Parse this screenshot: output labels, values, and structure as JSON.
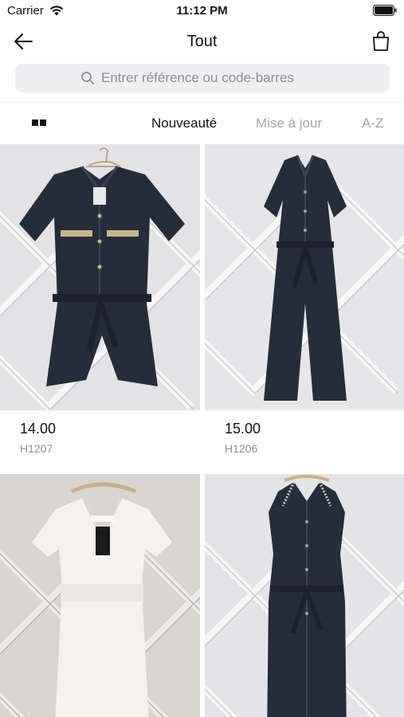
{
  "status_bar": {
    "carrier": "Carrier",
    "time": "11:12 PM"
  },
  "nav": {
    "title": "Tout"
  },
  "search": {
    "placeholder": "Entrer référence ou code-barres"
  },
  "sort": {
    "options": [
      "Nouveauté",
      "Mise à jour",
      "A-Z"
    ],
    "active_index": 0
  },
  "products": [
    {
      "price": "14.00",
      "ref": "H1207",
      "color": "navy",
      "garment": "short-sleeve playsuit with belt"
    },
    {
      "price": "15.00",
      "ref": "H1206",
      "color": "navy",
      "garment": "short-sleeve wide-leg jumpsuit with belt"
    },
    {
      "price": "",
      "ref": "",
      "color": "white",
      "garment": "eyelet lace playsuit"
    },
    {
      "price": "",
      "ref": "",
      "color": "navy",
      "garment": "sleeveless shirt dress with embroidered collar"
    }
  ],
  "colors": {
    "text_primary": "#111111",
    "text_secondary": "#8e8e93",
    "search_bg": "#efeff1",
    "garment_navy": "#262d3a",
    "garment_white": "#f4f2ee",
    "wall": "#e4e4e6"
  }
}
